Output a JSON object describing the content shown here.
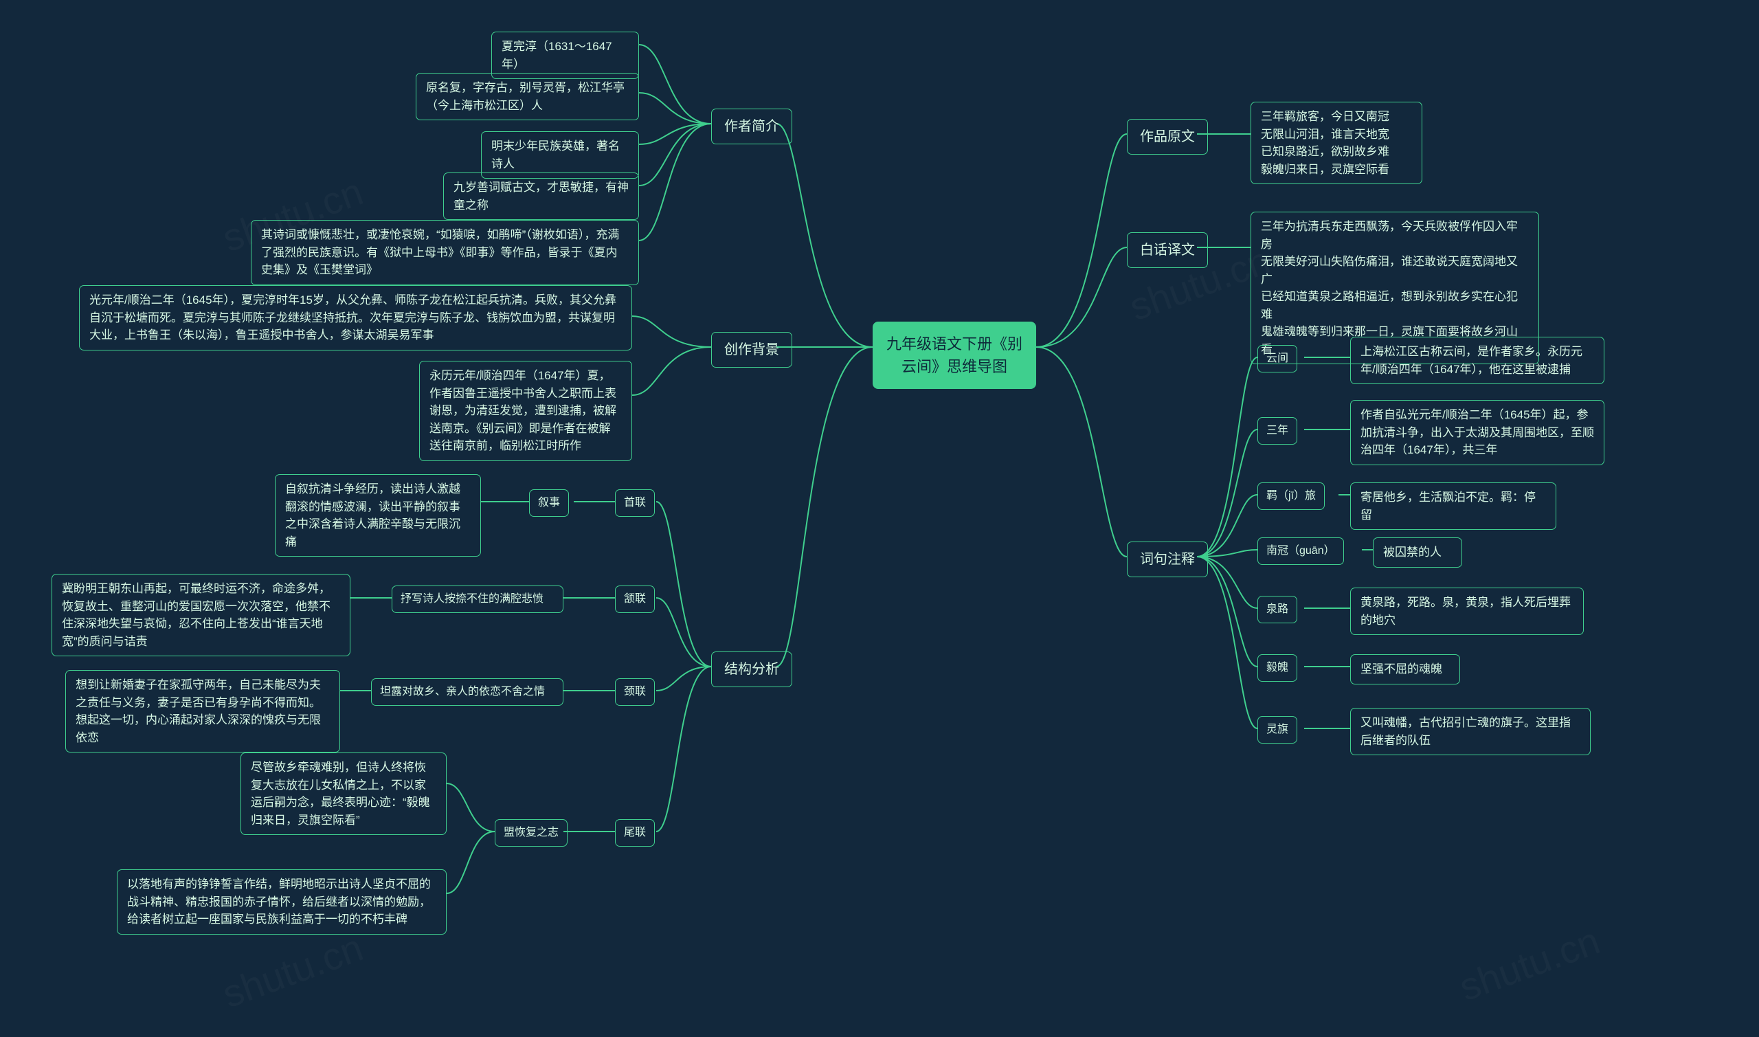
{
  "root": "九年级语文下册《别云间》思维导图",
  "left": {
    "author": {
      "label": "作者简介",
      "c1": "夏完淳（1631～1647年）",
      "c2": "原名复，字存古，别号灵胥，松江华亭（今上海市松江区）人",
      "c3": "明末少年民族英雄，著名诗人",
      "c4": "九岁善词赋古文，才思敏捷，有神童之称",
      "c5": "其诗词或慷慨悲壮，或凄怆哀婉，“如猿唳，如鹃啼”（谢枚如语），充满了强烈的民族意识。有《狱中上母书》《即事》等作品，皆录于《夏内史集》及《玉樊堂词》"
    },
    "background": {
      "label": "创作背景",
      "c1": "光元年/顺治二年（1645年），夏完淳时年15岁，从父允彝、师陈子龙在松江起兵抗清。兵败，其父允彝自沉于松塘而死。夏完淳与其师陈子龙继续坚持抵抗。次年夏完淳与陈子龙、钱旃饮血为盟，共谋复明大业，上书鲁王（朱以海），鲁王遥授中书舍人，参谋太湖吴易军事",
      "c2": "永历元年/顺治四年（1647年）夏，作者因鲁王遥授中书舍人之职而上表谢恩，为清廷发觉，遭到逮捕，被解送南京。《别云间》即是作者在被解送往南京前，临别松江时所作"
    },
    "structure": {
      "label": "结构分析",
      "s1": {
        "label": "首联",
        "sub": "叙事",
        "leaf": "自叙抗清斗争经历，读出诗人激越翻滚的情感波澜，读出平静的叙事之中深含着诗人满腔辛酸与无限沉痛"
      },
      "s2": {
        "label": "颔联",
        "sub": "抒写诗人按捺不住的满腔悲愤",
        "leaf": "冀盼明王朝东山再起，可最终时运不济，命途多舛，恢复故土、重整河山的爱国宏愿一次次落空，他禁不住深深地失望与哀恸，忍不住向上苍发出“谁言天地宽”的质问与诘责"
      },
      "s3": {
        "label": "颈联",
        "sub": "坦露对故乡、亲人的依恋不舍之情",
        "leaf": "想到让新婚妻子在家孤守两年，自己未能尽为夫之责任与义务，妻子是否已有身孕尚不得而知。想起这一切，内心涌起对家人深深的愧疚与无限依恋"
      },
      "s4": {
        "label": "尾联",
        "sub": "盟恢复之志",
        "leaf1": "尽管故乡牵魂难别，但诗人终将恢复大志放在儿女私情之上，不以家运后嗣为念，最终表明心迹：“毅魄归来日，灵旗空际看”",
        "leaf2": "以落地有声的铮铮誓言作结，鲜明地昭示出诗人坚贞不屈的战斗精神、精忠报国的赤子情怀，给后继者以深情的勉励，给读者树立起一座国家与民族利益高于一切的不朽丰碑"
      }
    }
  },
  "right": {
    "original": {
      "label": "作品原文",
      "text": "三年羁旅客，今日又南冠\n无限山河泪，谁言天地宽\n已知泉路近，欲别故乡难\n毅魄归来日，灵旗空际看"
    },
    "translation": {
      "label": "白话译文",
      "text": "三年为抗清兵东走西飘荡，今天兵败被俘作囚入牢房\n无限美好河山失陷伤痛泪，谁还敢说天庭宽阔地又广\n已经知道黄泉之路相逼近，想到永别故乡实在心犯难\n鬼雄魂魄等到归来那一日，灵旗下面要将故乡河山看"
    },
    "notes": {
      "label": "词句注释",
      "n1": {
        "k": "云间",
        "v": "上海松江区古称云间，是作者家乡。永历元年/顺治四年（1647年），他在这里被逮捕"
      },
      "n2": {
        "k": "三年",
        "v": "作者自弘光元年/顺治二年（1645年）起，参加抗清斗争，出入于太湖及其周围地区，至顺治四年（1647年），共三年"
      },
      "n3": {
        "k": "羁（jī）旅",
        "v": "寄居他乡，生活飘泊不定。羁：停留"
      },
      "n4": {
        "k": "南冠（guān）",
        "v": "被囚禁的人"
      },
      "n5": {
        "k": "泉路",
        "v": "黄泉路，死路。泉，黄泉，指人死后埋葬的地穴"
      },
      "n6": {
        "k": "毅魄",
        "v": "坚强不屈的魂魄"
      },
      "n7": {
        "k": "灵旗",
        "v": "又叫魂幡，古代招引亡魂的旗子。这里指后继者的队伍"
      }
    }
  },
  "watermark": "shutu.cn"
}
